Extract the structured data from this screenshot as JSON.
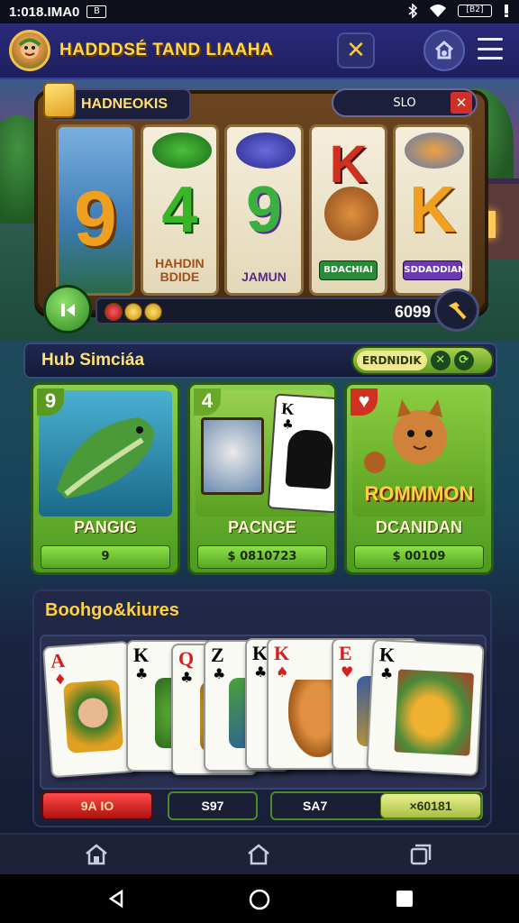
{
  "status_bar": {
    "time": "1:018.IMA0",
    "notif_label": "B",
    "battery_label": "[B2]"
  },
  "header": {
    "title": "HADDDSÉ  TAND LIAAHA",
    "close_glyph": "✕"
  },
  "slot": {
    "game_label": "HADNEOKIS",
    "right_pill": "SLO",
    "reels": [
      {
        "big": "9",
        "color": "#f0a020",
        "caption": ""
      },
      {
        "big": "4",
        "color": "#39b52a",
        "caption": "HAHDIN BDIDE"
      },
      {
        "big": "9",
        "color": "#3ab040",
        "caption": "JAMUN"
      },
      {
        "big": "K",
        "color": "#d03020",
        "caption": "BDACHIAI"
      },
      {
        "big": "K",
        "color": "#f0a020",
        "caption": "SDDADDIAN"
      }
    ],
    "credit_value": "6099"
  },
  "hub": {
    "title": "Hub Simciáa",
    "pill_label": "ERDNIDIK"
  },
  "games": [
    {
      "corner": "9",
      "name": "PANGIG",
      "price": "9",
      "title": ""
    },
    {
      "corner": "4",
      "name": "PACNGE",
      "price": "$ 0810723",
      "title": ""
    },
    {
      "corner": "",
      "name": "DCANIDAN",
      "price": "$ 00109",
      "title": "ROMMMON"
    }
  ],
  "bonus": {
    "title": "Boohgo&kiures",
    "cards": [
      {
        "rank": "A",
        "suit": "♦",
        "color": "#d02020"
      },
      {
        "rank": "K",
        "suit": "♣",
        "color": "#111"
      },
      {
        "rank": "Q",
        "suit": "♣",
        "color": "#d02020"
      },
      {
        "rank": "Z",
        "suit": "♣",
        "color": "#111"
      },
      {
        "rank": "K",
        "suit": "♣",
        "color": "#111"
      },
      {
        "rank": "K",
        "suit": "♠",
        "color": "#d02020"
      },
      {
        "rank": "E",
        "suit": "♥",
        "color": "#d02020"
      },
      {
        "rank": "K",
        "suit": "♣",
        "color": "#111"
      }
    ],
    "buttons": [
      "9A IO",
      "S97",
      "SA7",
      "×60181"
    ]
  }
}
